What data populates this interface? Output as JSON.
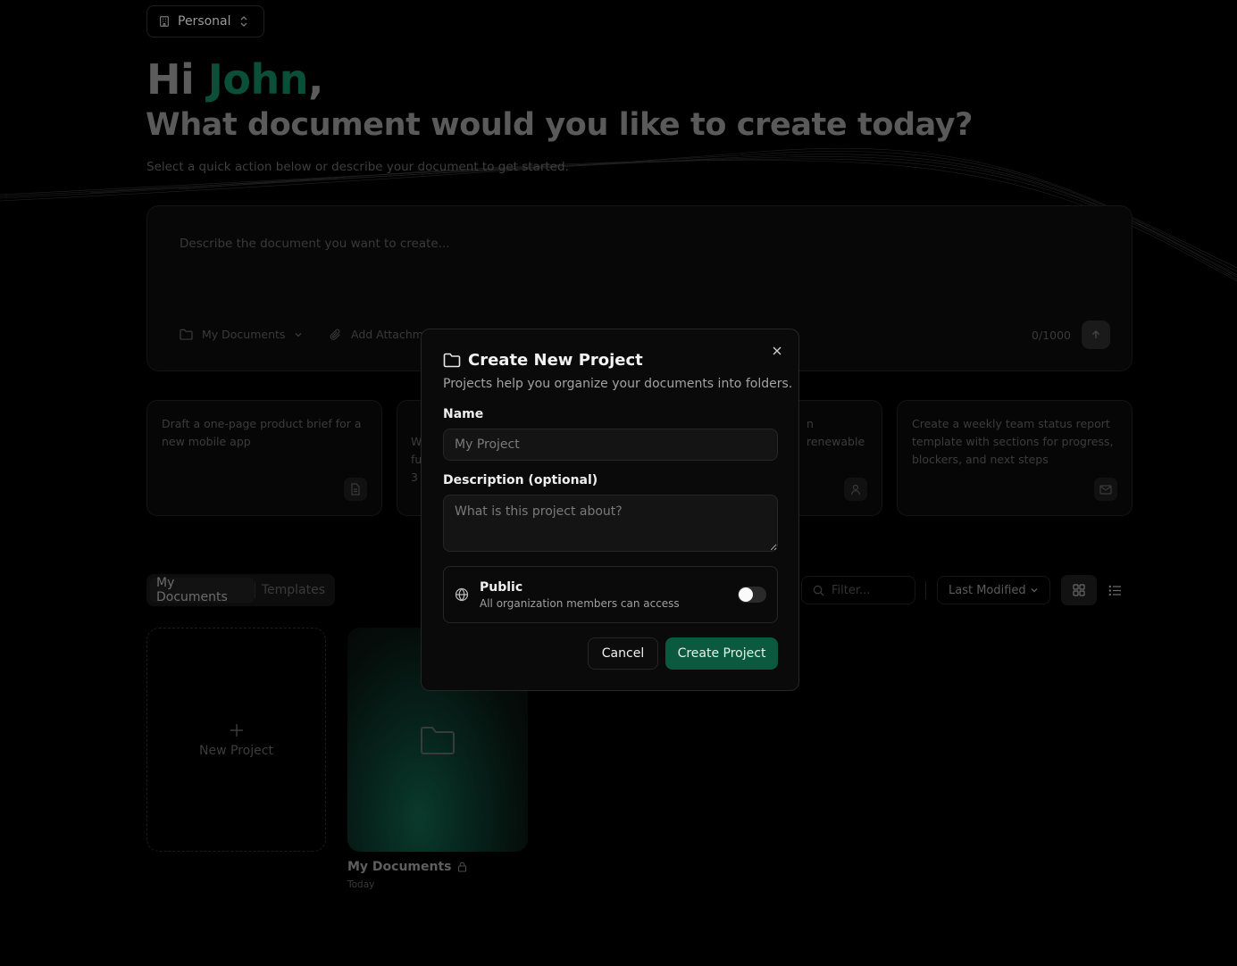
{
  "header": {
    "org_label": "Personal",
    "greeting_prefix": "Hi ",
    "user_name": "John",
    "greeting_suffix": ",",
    "headline": "What document would you like to create today?",
    "subtext": "Select a quick action below or describe your document to get started."
  },
  "composer": {
    "placeholder": "Describe the document you want to create...",
    "folder_label": "My Documents",
    "attach_label": "Add Attachme",
    "char_count": "0/1000"
  },
  "quick_actions": [
    {
      "text": "Draft a one-page product brief for a new mobile app",
      "icon": "document-icon"
    },
    {
      "text": "W\nfu\n3",
      "icon": ""
    },
    {
      "text": "n renewable",
      "icon": "person-icon"
    },
    {
      "text": "Create a weekly team status report template with sections for progress, blockers, and next steps",
      "icon": "mail-icon"
    }
  ],
  "documents": {
    "tabs": [
      "My Documents",
      "Templates"
    ],
    "active_tab": "My Documents",
    "filter_placeholder": "Filter...",
    "sort_label": "Last Modified",
    "new_project_label": "New Project",
    "folder": {
      "title": "My Documents",
      "date": "Today"
    }
  },
  "modal": {
    "title": "Create New Project",
    "description": "Projects help you organize your documents into folders.",
    "name_label": "Name",
    "name_placeholder": "My Project",
    "desc_label": "Description (optional)",
    "desc_placeholder": "What is this project about?",
    "public_title": "Public",
    "public_subtitle": "All organization members can access",
    "public_enabled": false,
    "cancel_label": "Cancel",
    "create_label": "Create Project",
    "accent_color": "#0b5a3f"
  }
}
